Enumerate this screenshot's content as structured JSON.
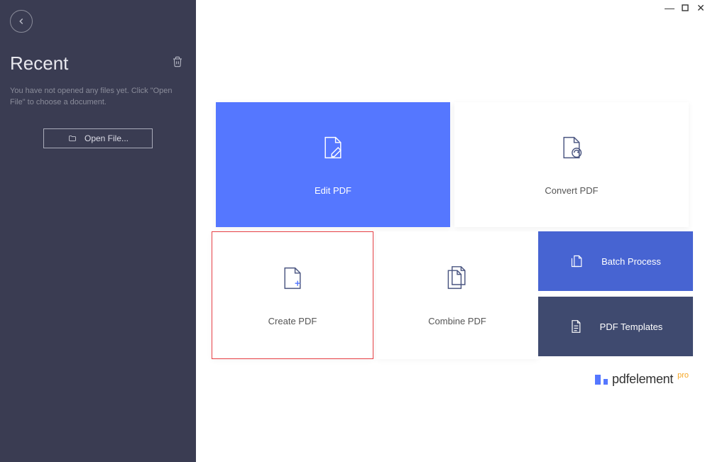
{
  "sidebar": {
    "title": "Recent",
    "empty_message": "You have not opened any files yet. Click \"Open File\" to choose a document.",
    "open_file_label": "Open File..."
  },
  "tiles": {
    "edit": "Edit PDF",
    "convert": "Convert PDF",
    "create": "Create PDF",
    "combine": "Combine PDF",
    "batch": "Batch Process",
    "templates": "PDF Templates"
  },
  "brand": {
    "name": "pdfelement",
    "suffix": "pro"
  }
}
